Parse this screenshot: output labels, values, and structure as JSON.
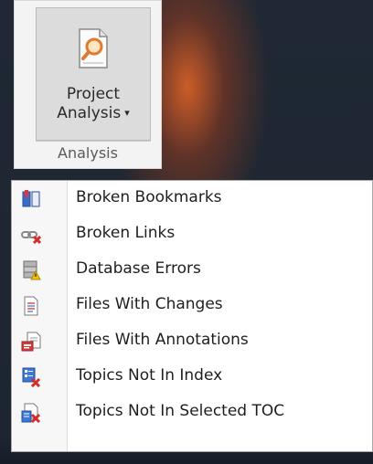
{
  "ribbon": {
    "button_line1": "Project",
    "button_line2": "Analysis",
    "caret": "▾",
    "group_label": "Analysis"
  },
  "menu": {
    "items": [
      {
        "label": "Broken Bookmarks",
        "icon": "broken-bookmarks-icon"
      },
      {
        "label": "Broken Links",
        "icon": "broken-links-icon"
      },
      {
        "label": "Database Errors",
        "icon": "database-errors-icon"
      },
      {
        "label": "Files With Changes",
        "icon": "files-with-changes-icon"
      },
      {
        "label": "Files With Annotations",
        "icon": "files-with-annotations-icon"
      },
      {
        "label": "Topics Not In Index",
        "icon": "topics-not-in-index-icon"
      },
      {
        "label": "Topics Not In Selected TOC",
        "icon": "topics-not-in-toc-icon"
      }
    ]
  },
  "colors": {
    "background": "#1f2834",
    "glow": "#d66028",
    "menu_bg": "#ffffff",
    "ribbon_bg": "#f3f3f3"
  }
}
